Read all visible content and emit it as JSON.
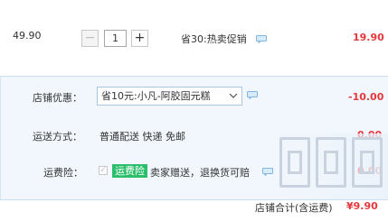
{
  "item": {
    "price": "49.90",
    "quantity": {
      "minus": "−",
      "value": "1",
      "plus": "+"
    },
    "promotion": "省30:热卖促销",
    "subtotal": "19.90"
  },
  "shop": {
    "coupon": {
      "label": "店铺优惠：",
      "selected": "省10元:小凡-阿胶固元糕",
      "amount": "-10.00"
    },
    "shipping": {
      "label": "运送方式：",
      "value": "普通配送 快递 免邮",
      "amount": "0.00"
    },
    "insurance": {
      "label": "运费险：",
      "tag": "运费险",
      "description": "卖家赠送，退换货可赔",
      "amount": "0.00"
    },
    "total": {
      "label": "店铺合计(含运费)",
      "amount": "¥9.90"
    }
  },
  "colors": {
    "accent_red": "#e4393c",
    "panel_bg": "#f1f7fc",
    "tag_green": "#2bbf6b"
  }
}
